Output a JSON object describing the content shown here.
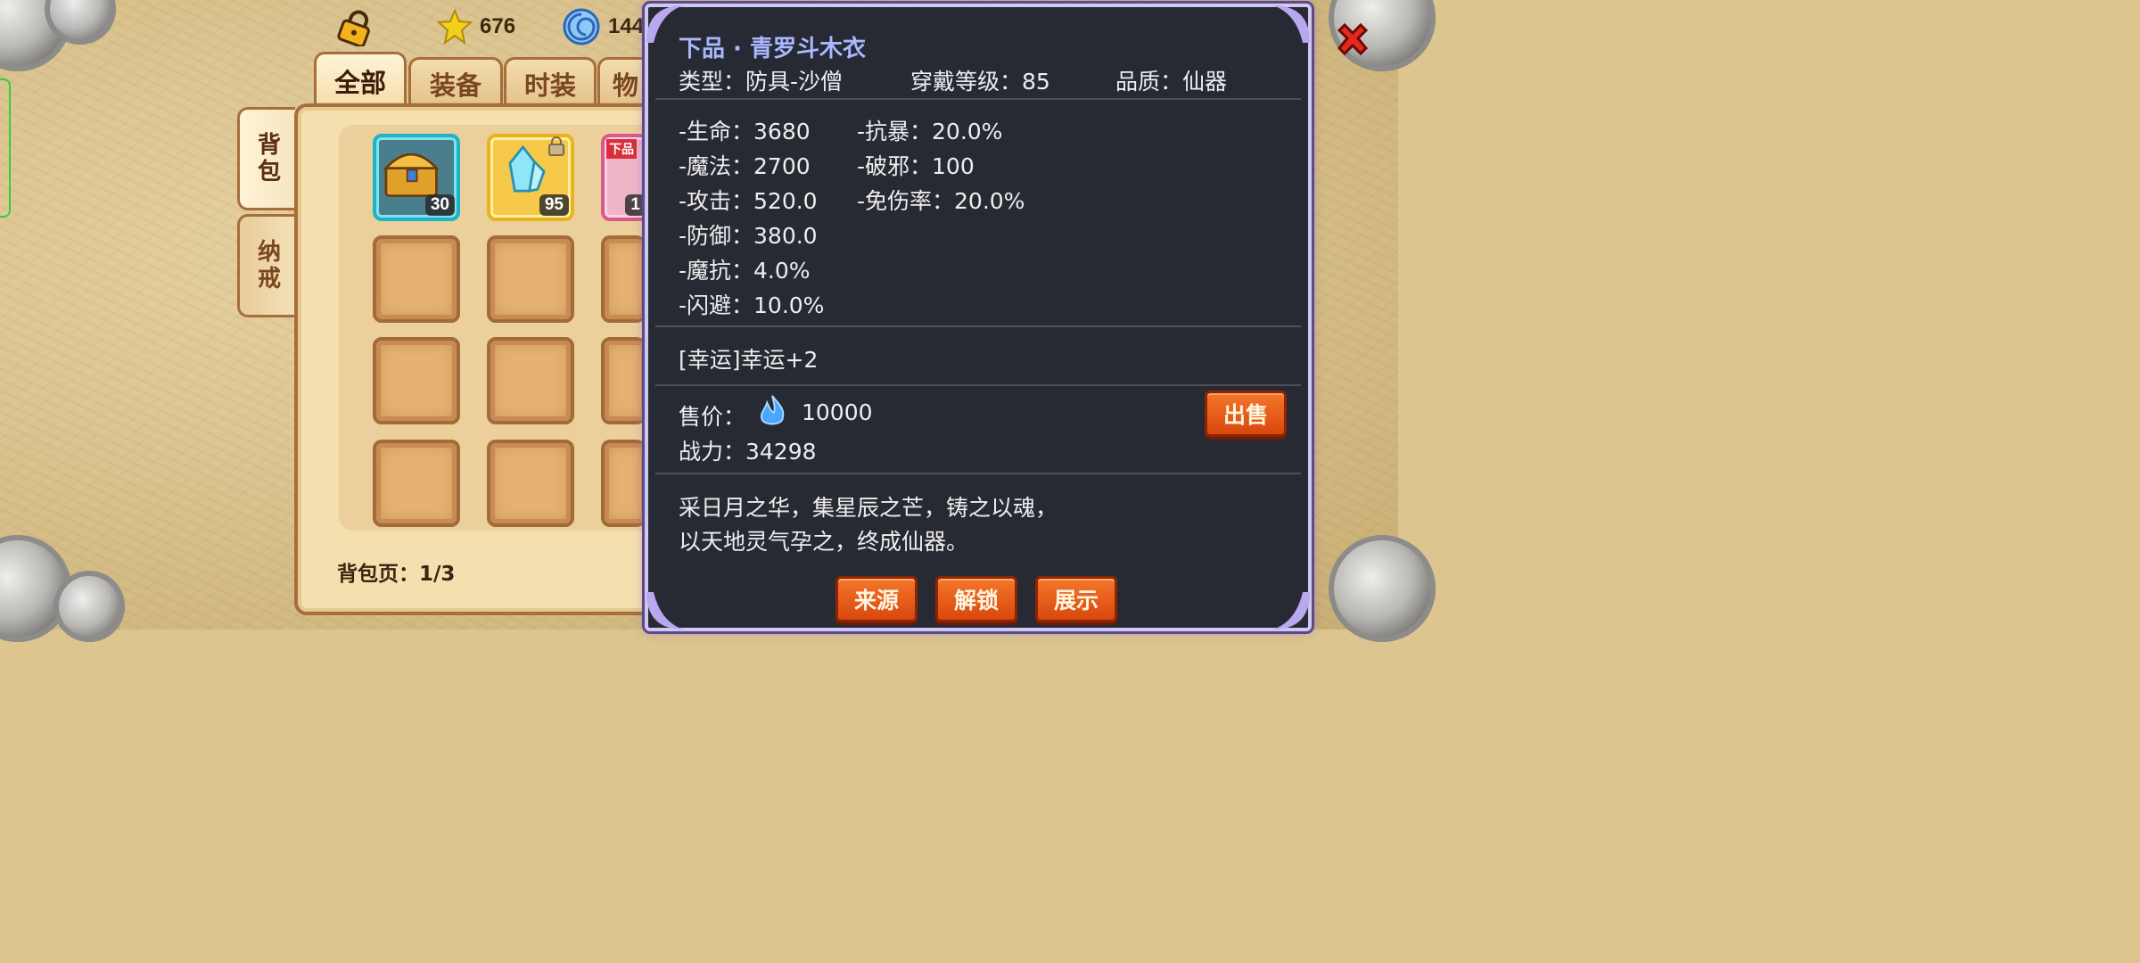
{
  "currencies": {
    "stars": "676",
    "gems_partial": "144"
  },
  "tabs": [
    {
      "label": "全部"
    },
    {
      "label": "装备"
    },
    {
      "label": "时装"
    },
    {
      "label": "物"
    }
  ],
  "side_tabs": [
    {
      "label": "背包"
    },
    {
      "label": "纳戒"
    }
  ],
  "slots": [
    {
      "count": "30"
    },
    {
      "count": "95"
    },
    {
      "badge": "下品",
      "count": "1"
    }
  ],
  "bag": {
    "page_label": "背包页：1/3"
  },
  "tooltip": {
    "title": "下品 · 青罗斗木衣",
    "type": "类型：防具-沙僧",
    "level": "穿戴等级：85",
    "quality": "品质：仙器",
    "stats_left": [
      "-生命：3680",
      "-魔法：2700",
      "-攻击：520.0",
      "-防御：380.0",
      "-魔抗：4.0%",
      "-闪避：10.0%"
    ],
    "stats_right": [
      "-抗暴：20.0%",
      "-破邪：100",
      "-免伤率：20.0%"
    ],
    "extra": "[幸运]幸运+2",
    "price_label": "售价：",
    "price_value": "10000",
    "power": "战力：34298",
    "desc_line1": "采日月之华，集星辰之芒，铸之以魂，",
    "desc_line2": "以天地灵气孕之，终成仙器。",
    "sell_button": "出售",
    "buttons": {
      "source": "来源",
      "unlock": "解锁",
      "show": "展示"
    }
  },
  "colors": {
    "panel_bg": "#282a33",
    "title": "#a9b8ff",
    "button": "#e85a1c",
    "border": "#cfc8ef"
  }
}
